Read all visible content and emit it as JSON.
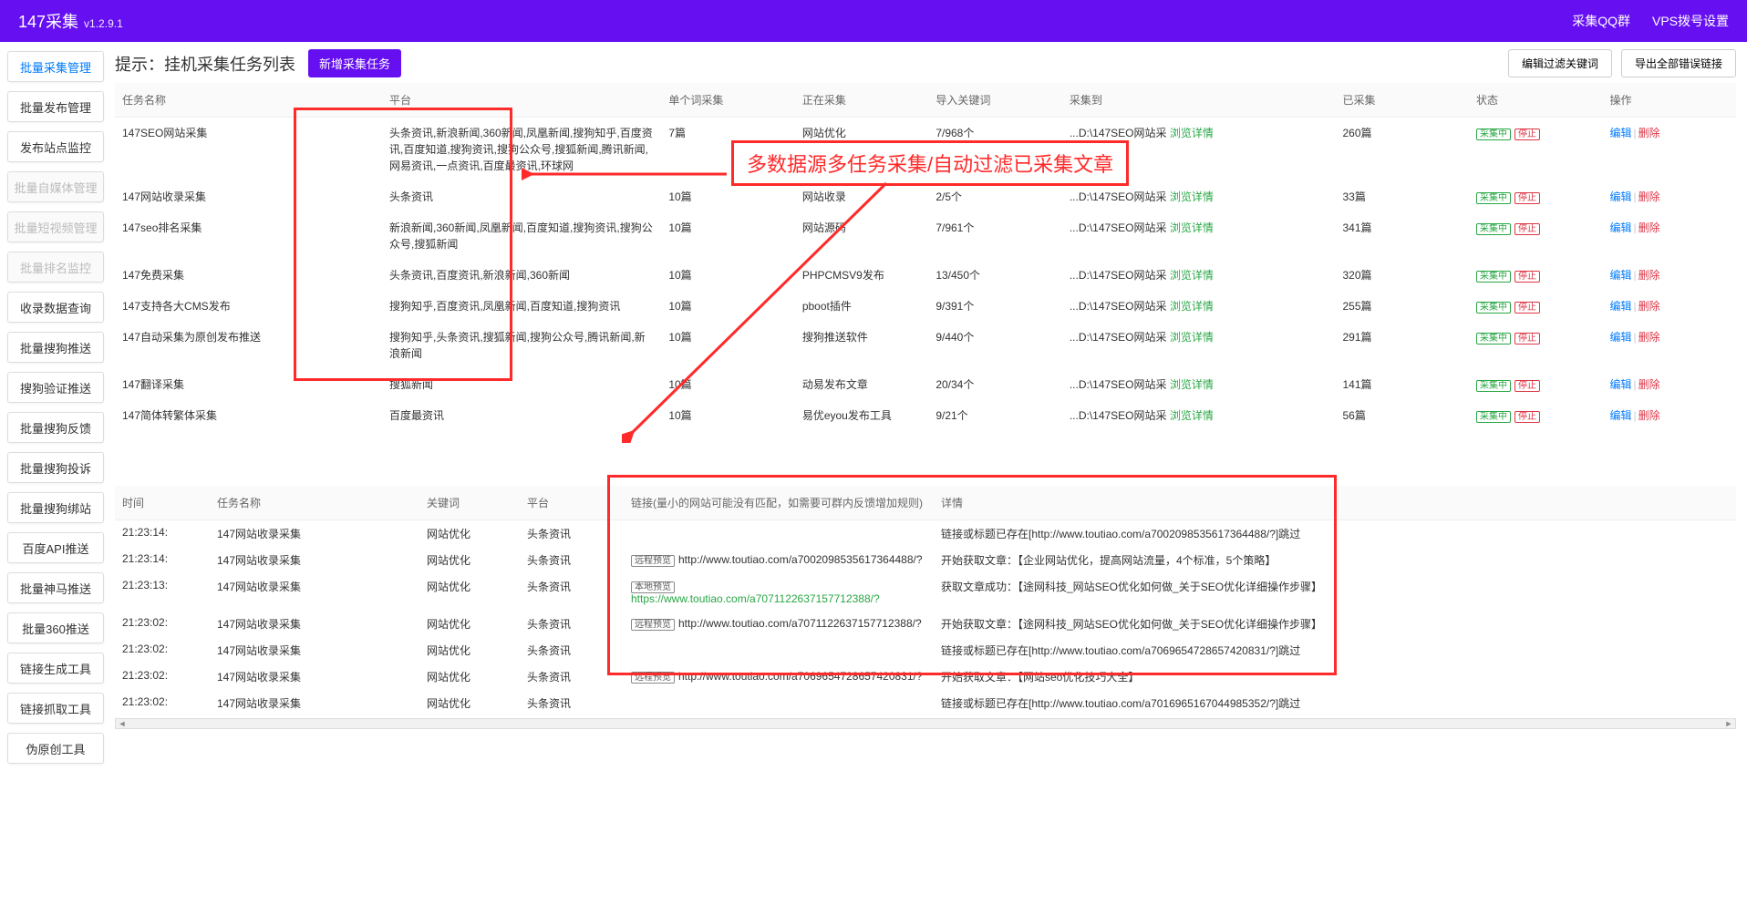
{
  "header": {
    "title": "147采集",
    "version": "v1.2.9.1",
    "qq_group": "采集QQ群",
    "vps_dial": "VPS拨号设置"
  },
  "sidebar": {
    "items": [
      {
        "label": "批量采集管理",
        "state": "active"
      },
      {
        "label": "批量发布管理",
        "state": ""
      },
      {
        "label": "发布站点监控",
        "state": ""
      },
      {
        "label": "批量自媒体管理",
        "state": "disabled"
      },
      {
        "label": "批量短视频管理",
        "state": "disabled"
      },
      {
        "label": "批量排名监控",
        "state": "disabled"
      },
      {
        "label": "收录数据查询",
        "state": ""
      },
      {
        "label": "批量搜狗推送",
        "state": ""
      },
      {
        "label": "搜狗验证推送",
        "state": ""
      },
      {
        "label": "批量搜狗反馈",
        "state": ""
      },
      {
        "label": "批量搜狗投诉",
        "state": ""
      },
      {
        "label": "批量搜狗绑站",
        "state": ""
      },
      {
        "label": "百度API推送",
        "state": ""
      },
      {
        "label": "批量神马推送",
        "state": ""
      },
      {
        "label": "批量360推送",
        "state": ""
      },
      {
        "label": "链接生成工具",
        "state": ""
      },
      {
        "label": "链接抓取工具",
        "state": ""
      },
      {
        "label": "伪原创工具",
        "state": ""
      }
    ]
  },
  "page": {
    "title": "提示：挂机采集任务列表",
    "new_task": "新增采集任务",
    "edit_filter": "编辑过滤关键词",
    "export_errors": "导出全部错误链接"
  },
  "annotation": {
    "text": "多数据源多任务采集/自动过滤已采集文章"
  },
  "tasks": {
    "headers": {
      "name": "任务名称",
      "platform": "平台",
      "single": "单个词采集",
      "collecting": "正在采集",
      "keywords": "导入关键词",
      "collect_to": "采集到",
      "collected": "已采集",
      "status": "状态",
      "ops": "操作"
    },
    "rows": [
      {
        "name": "147SEO网站采集",
        "platform": "头条资讯,新浪新闻,360新闻,凤凰新闻,搜狗知乎,百度资讯,百度知道,搜狗资讯,搜狗公众号,搜狐新闻,腾讯新闻,网易资讯,一点资讯,百度最资讯,环球网",
        "single": "7篇",
        "collecting": "网站优化",
        "keywords": "7/968个",
        "collect_to": "...D:\\147SEO网站采",
        "detail": "浏览详情",
        "collected": "260篇",
        "status_run": "采集中",
        "status_stop": "停止",
        "edit": "编辑",
        "del": "删除"
      },
      {
        "name": "147网站收录采集",
        "platform": "头条资讯",
        "single": "10篇",
        "collecting": "网站收录",
        "keywords": "2/5个",
        "collect_to": "...D:\\147SEO网站采",
        "detail": "浏览详情",
        "collected": "33篇",
        "status_run": "采集中",
        "status_stop": "停止",
        "edit": "编辑",
        "del": "删除"
      },
      {
        "name": "147seo排名采集",
        "platform": "新浪新闻,360新闻,凤凰新闻,百度知道,搜狗资讯,搜狗公众号,搜狐新闻",
        "single": "10篇",
        "collecting": "网站源码",
        "keywords": "7/961个",
        "collect_to": "...D:\\147SEO网站采",
        "detail": "浏览详情",
        "collected": "341篇",
        "status_run": "采集中",
        "status_stop": "停止",
        "edit": "编辑",
        "del": "删除"
      },
      {
        "name": "147免费采集",
        "platform": "头条资讯,百度资讯,新浪新闻,360新闻",
        "single": "10篇",
        "collecting": "PHPCMSV9发布",
        "keywords": "13/450个",
        "collect_to": "...D:\\147SEO网站采",
        "detail": "浏览详情",
        "collected": "320篇",
        "status_run": "采集中",
        "status_stop": "停止",
        "edit": "编辑",
        "del": "删除"
      },
      {
        "name": "147支持各大CMS发布",
        "platform": "搜狗知乎,百度资讯,凤凰新闻,百度知道,搜狗资讯",
        "single": "10篇",
        "collecting": "pboot插件",
        "keywords": "9/391个",
        "collect_to": "...D:\\147SEO网站采",
        "detail": "浏览详情",
        "collected": "255篇",
        "status_run": "采集中",
        "status_stop": "停止",
        "edit": "编辑",
        "del": "删除"
      },
      {
        "name": "147自动采集为原创发布推送",
        "platform": "搜狗知乎,头条资讯,搜狐新闻,搜狗公众号,腾讯新闻,新浪新闻",
        "single": "10篇",
        "collecting": "搜狗推送软件",
        "keywords": "9/440个",
        "collect_to": "...D:\\147SEO网站采",
        "detail": "浏览详情",
        "collected": "291篇",
        "status_run": "采集中",
        "status_stop": "停止",
        "edit": "编辑",
        "del": "删除"
      },
      {
        "name": "147翻译采集",
        "platform": "搜狐新闻",
        "single": "10篇",
        "collecting": "动易发布文章",
        "keywords": "20/34个",
        "collect_to": "...D:\\147SEO网站采",
        "detail": "浏览详情",
        "collected": "141篇",
        "status_run": "采集中",
        "status_stop": "停止",
        "edit": "编辑",
        "del": "删除"
      },
      {
        "name": "147简体转繁体采集",
        "platform": "百度最资讯",
        "single": "10篇",
        "collecting": "易优eyou发布工具",
        "keywords": "9/21个",
        "collect_to": "...D:\\147SEO网站采",
        "detail": "浏览详情",
        "collected": "56篇",
        "status_run": "采集中",
        "status_stop": "停止",
        "edit": "编辑",
        "del": "删除"
      }
    ]
  },
  "logs": {
    "headers": {
      "time": "时间",
      "task": "任务名称",
      "keyword": "关键词",
      "platform": "平台",
      "link": "链接(量小的网站可能没有匹配，如需要可群内反馈增加规则)",
      "detail": "详情"
    },
    "rows": [
      {
        "time": "21:23:14:",
        "task": "147网站收录采集",
        "keyword": "网站优化",
        "platform": "头条资讯",
        "badge": "",
        "link": "",
        "link_class": "",
        "detail": "链接或标题已存在[http://www.toutiao.com/a7002098535617364488/?]跳过"
      },
      {
        "time": "21:23:14:",
        "task": "147网站收录采集",
        "keyword": "网站优化",
        "platform": "头条资讯",
        "badge": "远程预览",
        "link": "http://www.toutiao.com/a7002098535617364488/?",
        "link_class": "remote",
        "detail": "开始获取文章：【企业网站优化，提高网站流量，4个标准，5个策略】"
      },
      {
        "time": "21:23:13:",
        "task": "147网站收录采集",
        "keyword": "网站优化",
        "platform": "头条资讯",
        "badge": "本地预览",
        "link": "https://www.toutiao.com/a7071122637157712388/?",
        "link_class": "local",
        "detail": "获取文章成功：【途网科技_网站SEO优化如何做_关于SEO优化详细操作步骤】"
      },
      {
        "time": "21:23:02:",
        "task": "147网站收录采集",
        "keyword": "网站优化",
        "platform": "头条资讯",
        "badge": "远程预览",
        "link": "http://www.toutiao.com/a7071122637157712388/?",
        "link_class": "remote",
        "detail": "开始获取文章：【途网科技_网站SEO优化如何做_关于SEO优化详细操作步骤】"
      },
      {
        "time": "21:23:02:",
        "task": "147网站收录采集",
        "keyword": "网站优化",
        "platform": "头条资讯",
        "badge": "",
        "link": "",
        "link_class": "",
        "detail": "链接或标题已存在[http://www.toutiao.com/a7069654728657420831/?]跳过"
      },
      {
        "time": "21:23:02:",
        "task": "147网站收录采集",
        "keyword": "网站优化",
        "platform": "头条资讯",
        "badge": "远程预览",
        "link": "http://www.toutiao.com/a7069654728657420831/?",
        "link_class": "remote",
        "detail": "开始获取文章：【网站seo优化技巧大全】"
      },
      {
        "time": "21:23:02:",
        "task": "147网站收录采集",
        "keyword": "网站优化",
        "platform": "头条资讯",
        "badge": "",
        "link": "",
        "link_class": "",
        "detail": "链接或标题已存在[http://www.toutiao.com/a7016965167044985352/?]跳过"
      }
    ]
  }
}
